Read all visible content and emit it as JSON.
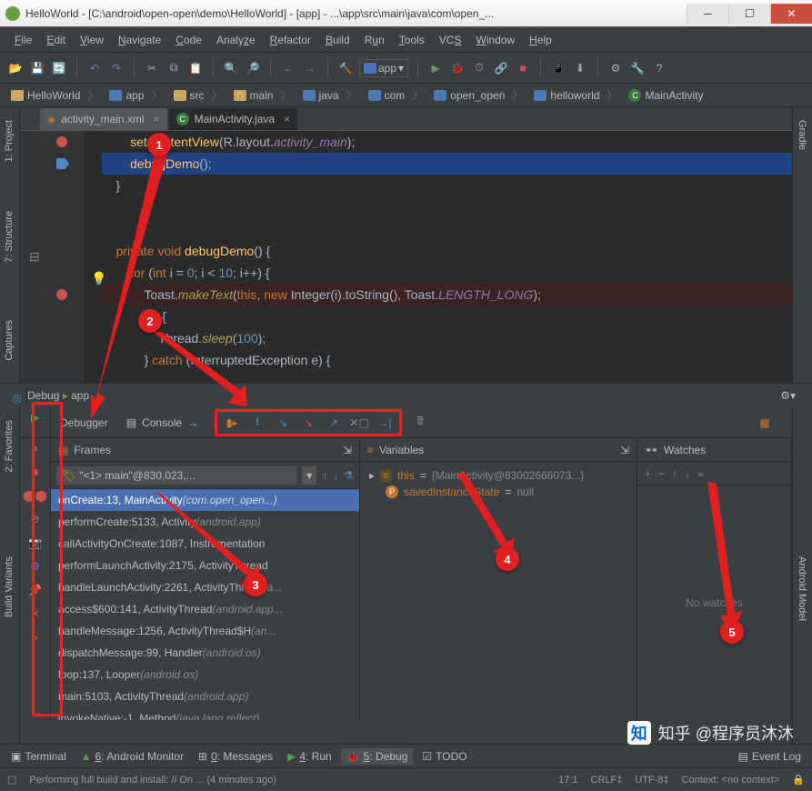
{
  "window": {
    "title": "HelloWorld - [C:\\android\\open-open\\demo\\HelloWorld] - [app] - ...\\app\\src\\main\\java\\com\\open_..."
  },
  "menu": {
    "file": "File",
    "edit": "Edit",
    "view": "View",
    "navigate": "Navigate",
    "code": "Code",
    "analyze": "Analyze",
    "refactor": "Refactor",
    "build": "Build",
    "run": "Run",
    "tools": "Tools",
    "vcs": "VCS",
    "window": "Window",
    "help": "Help"
  },
  "runconfig": {
    "label": "app"
  },
  "breadcrumbs": [
    "HelloWorld",
    "app",
    "src",
    "main",
    "java",
    "com",
    "open_open",
    "helloworld",
    "MainActivity"
  ],
  "file_tabs": [
    {
      "label": "activity_main.xml",
      "active": false
    },
    {
      "label": "MainActivity.java",
      "active": true
    }
  ],
  "side_tabs": {
    "project": "1: Project",
    "structure": "7: Structure",
    "captures": "Captures",
    "favorites": "2: Favorites",
    "build_variants": "Build Variants",
    "gradle": "Gradle",
    "android_model": "Android Model"
  },
  "code_lines": [
    "        setContentView(R.layout.activity_main);",
    "        debugDemo();",
    "    }",
    "",
    "",
    "    private void debugDemo() {",
    "        for (int i = 0; i < 10; i++) {",
    "            Toast.makeText(this, new Integer(i).toString(), Toast.LENGTH_LONG);",
    "            try {",
    "                Thread.sleep(100);",
    "            } catch (InterruptedException e) {"
  ],
  "debug": {
    "title": "Debug",
    "config": "app",
    "tabs": {
      "debugger": "Debugger",
      "console": "Console"
    },
    "frames": {
      "title": "Frames",
      "thread": "\"<1> main\"@830,023,...",
      "list": [
        {
          "t": "onCreate:13, MainActivity ",
          "ctx": "(com.open_open...)",
          "sel": true
        },
        {
          "t": "performCreate:5133, Activity ",
          "ctx": "(android.app)"
        },
        {
          "t": "callActivityOnCreate:1087, Instrumentation",
          "ctx": ""
        },
        {
          "t": "performLaunchActivity:2175, ActivityThread",
          "ctx": ""
        },
        {
          "t": "handleLaunchActivity:2261, ActivityThread ",
          "ctx": "(a..."
        },
        {
          "t": "access$600:141, ActivityThread ",
          "ctx": "(android.app..."
        },
        {
          "t": "handleMessage:1256, ActivityThread$H ",
          "ctx": "(an..."
        },
        {
          "t": "dispatchMessage:99, Handler ",
          "ctx": "(android.os)"
        },
        {
          "t": "loop:137, Looper ",
          "ctx": "(android.os)"
        },
        {
          "t": "main:5103, ActivityThread ",
          "ctx": "(android.app)"
        },
        {
          "t": "invokeNative:-1, Method ",
          "ctx": "(java.lang.reflect)"
        }
      ]
    },
    "variables": {
      "title": "Variables",
      "rows": [
        {
          "name": "this",
          "eq": " = ",
          "val": "{MainActivity@83002666073...}"
        },
        {
          "name": "savedInstanceState",
          "eq": " = ",
          "val": "null"
        }
      ]
    },
    "watches": {
      "title": "Watches",
      "empty": "No watches"
    }
  },
  "bottom_tabs": {
    "terminal": "Terminal",
    "monitor": "6: Android Monitor",
    "messages": "0: Messages",
    "run": "4: Run",
    "debug": "5: Debug",
    "todo": "TODO",
    "eventlog": "Event Log"
  },
  "status": {
    "msg": "Performing full build and install: // On ... (4 minutes ago)",
    "pos": "17:1",
    "crlf": "CRLF",
    "enc": "UTF-8",
    "ctx": "Context: <no context>"
  },
  "annotations": {
    "1": "1",
    "2": "2",
    "3": "3",
    "4": "4",
    "5": "5"
  },
  "watermark": "知乎 @程序员沐沐"
}
